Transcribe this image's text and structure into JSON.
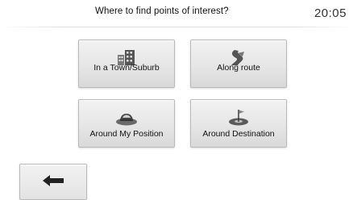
{
  "header": {
    "title": "Where to find points of interest?",
    "clock": "20:05"
  },
  "options": [
    {
      "label": "In a Town/Suburb",
      "icon": "town-buildings-icon"
    },
    {
      "label": "Along route",
      "icon": "road-route-icon"
    },
    {
      "label": "Around My Position",
      "icon": "vehicle-position-icon"
    },
    {
      "label": "Around Destination",
      "icon": "destination-flag-icon"
    }
  ],
  "back": {
    "icon": "left-arrow-icon"
  },
  "colors": {
    "tile_top": "#f2f2f2",
    "tile_bottom": "#d9d9d9",
    "tile_border": "#b9b9b9",
    "icon": "#555555"
  }
}
